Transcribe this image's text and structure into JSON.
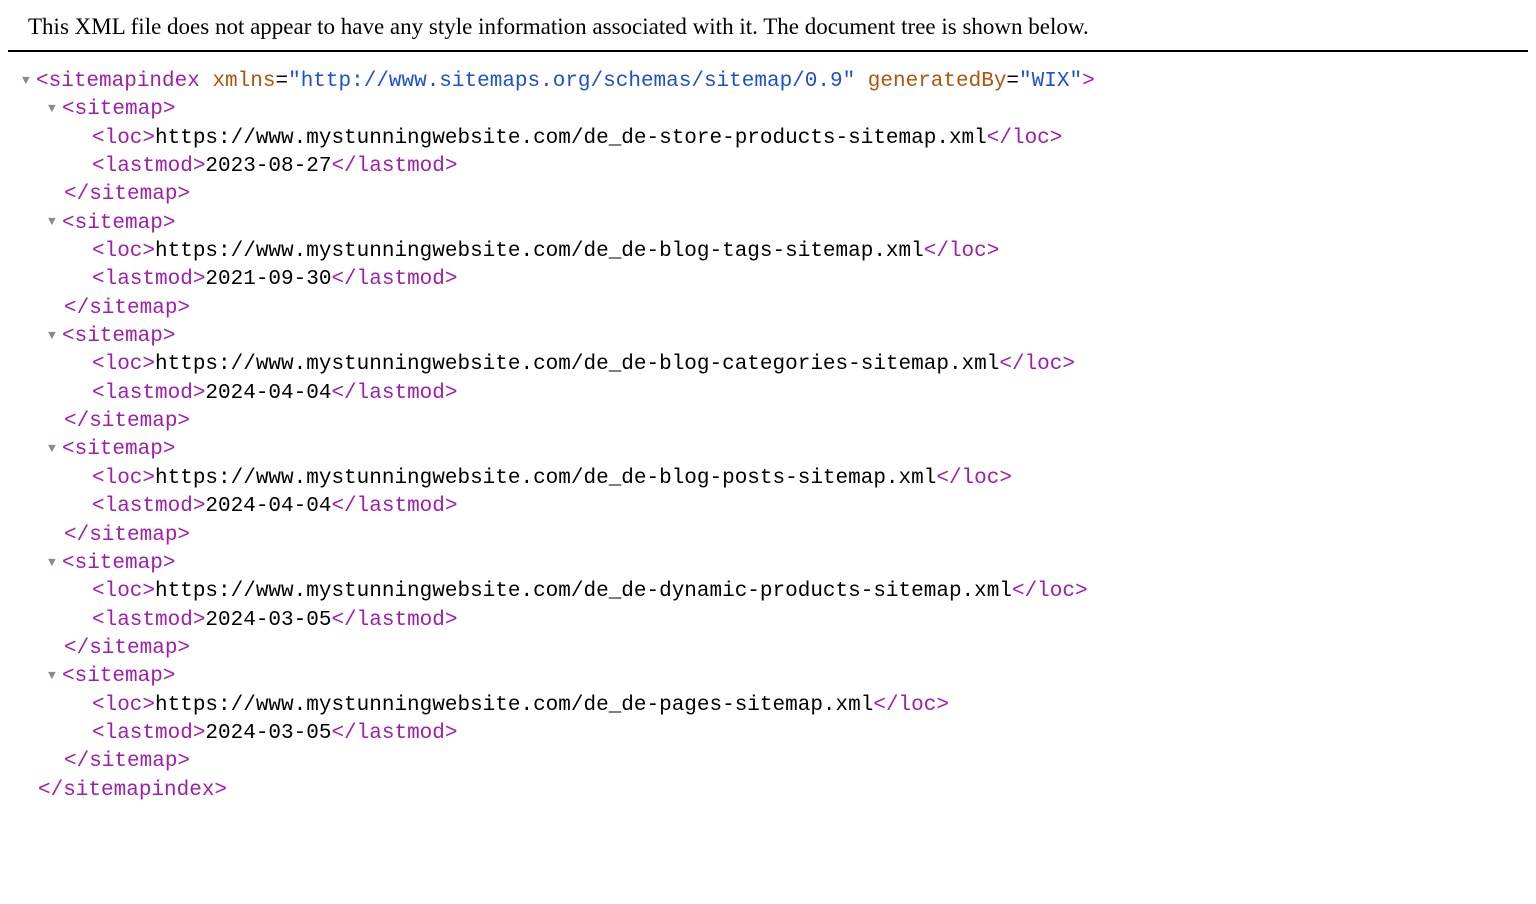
{
  "header": {
    "message": "This XML file does not appear to have any style information associated with it. The document tree is shown below."
  },
  "root": {
    "name": "sitemapindex",
    "attrs": {
      "xmlns_name": "xmlns",
      "xmlns_value": "http://www.sitemaps.org/schemas/sitemap/0.9",
      "gen_name": "generatedBy",
      "gen_value": "WIX"
    }
  },
  "tags": {
    "sitemap_open": "<sitemap>",
    "sitemap_close": "</sitemap>",
    "loc_open": "<loc>",
    "loc_close": "</loc>",
    "lastmod_open": "<lastmod>",
    "lastmod_close": "</lastmod>",
    "root_close": "</sitemapindex>"
  },
  "sitemaps": [
    {
      "loc": "https://www.mystunningwebsite.com/de_de-store-products-sitemap.xml",
      "lastmod": "2023-08-27"
    },
    {
      "loc": "https://www.mystunningwebsite.com/de_de-blog-tags-sitemap.xml",
      "lastmod": "2021-09-30"
    },
    {
      "loc": "https://www.mystunningwebsite.com/de_de-blog-categories-sitemap.xml",
      "lastmod": "2024-04-04"
    },
    {
      "loc": "https://www.mystunningwebsite.com/de_de-blog-posts-sitemap.xml",
      "lastmod": "2024-04-04"
    },
    {
      "loc": "https://www.mystunningwebsite.com/de_de-dynamic-products-sitemap.xml",
      "lastmod": "2024-03-05"
    },
    {
      "loc": "https://www.mystunningwebsite.com/de_de-pages-sitemap.xml",
      "lastmod": "2024-03-05"
    }
  ],
  "icons": {
    "disclosure_open": "▼"
  }
}
